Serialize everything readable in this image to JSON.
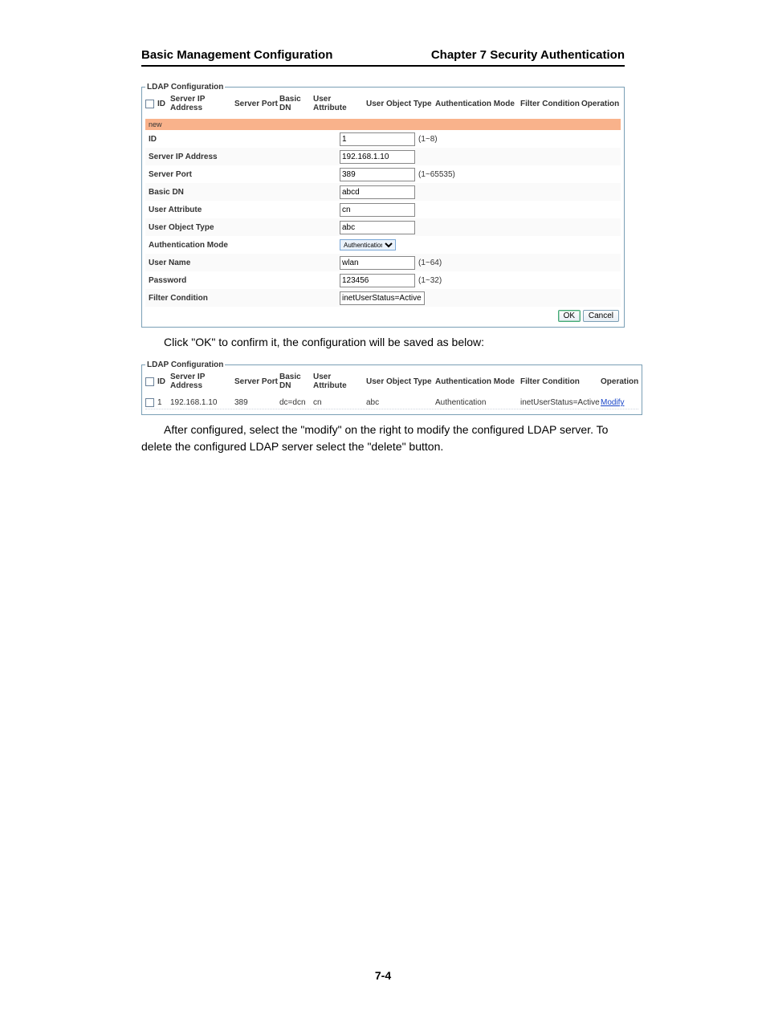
{
  "header": {
    "left": "Basic Management Configuration",
    "right": "Chapter 7 Security Authentication"
  },
  "ldap1": {
    "legend": "LDAP Configuration",
    "cols": {
      "id": "ID",
      "serverip": "Server IP Address",
      "port": "Server Port",
      "basicdn": "Basic DN",
      "userattr": "User Attribute",
      "userobj": "User Object Type",
      "authmode": "Authentication Mode",
      "filter": "Filter Condition",
      "operation": "Operation"
    },
    "newbar": "new",
    "form": {
      "id": {
        "label": "ID",
        "value": "1",
        "hint": "(1~8)"
      },
      "serverip": {
        "label": "Server IP Address",
        "value": "192.168.1.10"
      },
      "port": {
        "label": "Server Port",
        "value": "389",
        "hint": "(1~65535)"
      },
      "basicdn": {
        "label": "Basic DN",
        "value": "abcd"
      },
      "userattr": {
        "label": "User Attribute",
        "value": "cn"
      },
      "userobj": {
        "label": "User Object Type",
        "value": "abc"
      },
      "authmode": {
        "label": "Authentication Mode",
        "value": "Authentication"
      },
      "username": {
        "label": "User Name",
        "value": "wlan",
        "hint": "(1~64)"
      },
      "password": {
        "label": "Password",
        "value": "123456",
        "hint": "(1~32)"
      },
      "filter": {
        "label": "Filter Condition",
        "value": "inetUserStatus=Active"
      }
    },
    "buttons": {
      "ok": "OK",
      "cancel": "Cancel"
    }
  },
  "para1": "Click \"OK\" to confirm it, the configuration will be saved as below:",
  "ldap2": {
    "legend": "LDAP Configuration",
    "cols": {
      "id": "ID",
      "serverip": "Server IP Address",
      "port": "Server Port",
      "basicdn": "Basic DN",
      "userattr": "User Attribute",
      "userobj": "User Object Type",
      "authmode": "Authentication Mode",
      "filter": "Filter Condition",
      "operation": "Operation"
    },
    "row": {
      "id": "1",
      "serverip": "192.168.1.10",
      "port": "389",
      "basicdn": "dc=dcn",
      "userattr": "cn",
      "userobj": "abc",
      "authmode": "Authentication",
      "filter": "inetUserStatus=Active",
      "operation": "Modify"
    }
  },
  "para2": "After configured, select the \"modify\" on the right to modify the configured LDAP server. To delete the configured LDAP server select the \"delete\" button.",
  "pagenum": "7-4"
}
